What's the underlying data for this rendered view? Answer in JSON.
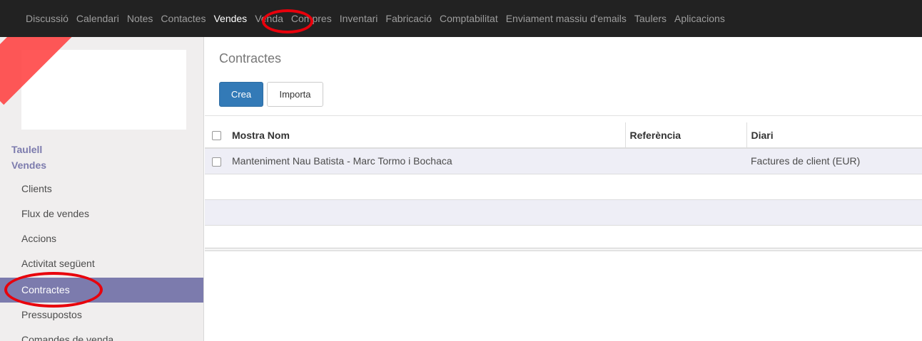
{
  "topbar": {
    "menu": [
      {
        "label": "Discussió",
        "active": false
      },
      {
        "label": "Calendari",
        "active": false
      },
      {
        "label": "Notes",
        "active": false
      },
      {
        "label": "Contactes",
        "active": false
      },
      {
        "label": "Vendes",
        "active": true
      },
      {
        "label": "Venda",
        "active": false
      },
      {
        "label": "Compres",
        "active": false
      },
      {
        "label": "Inventari",
        "active": false
      },
      {
        "label": "Fabricació",
        "active": false
      },
      {
        "label": "Comptabilitat",
        "active": false
      },
      {
        "label": "Enviament massiu d'emails",
        "active": false
      },
      {
        "label": "Taulers",
        "active": false
      },
      {
        "label": "Aplicacions",
        "active": false
      }
    ]
  },
  "sidebar": {
    "section_taulell": "Taulell",
    "section_vendes": "Vendes",
    "items": [
      {
        "label": "Clients",
        "active": false
      },
      {
        "label": "Flux de vendes",
        "active": false
      },
      {
        "label": "Accions",
        "active": false
      },
      {
        "label": "Activitat següent",
        "active": false
      },
      {
        "label": "Contractes",
        "active": true
      },
      {
        "label": "Pressupostos",
        "active": false
      },
      {
        "label": "Comandes de venda",
        "active": false
      }
    ]
  },
  "main": {
    "breadcrumb": "Contractes",
    "create_label": "Crea",
    "import_label": "Importa",
    "table": {
      "headers": [
        "Mostra Nom",
        "Referència",
        "Diari"
      ],
      "rows": [
        {
          "name": "Manteniment Nau Batista - Marc Tormo i Bochaca",
          "reference": "",
          "journal": "Factures de client (EUR)"
        },
        {
          "name": "",
          "reference": "",
          "journal": ""
        },
        {
          "name": "",
          "reference": "",
          "journal": ""
        },
        {
          "name": "",
          "reference": "",
          "journal": ""
        }
      ]
    }
  },
  "colors": {
    "topbar_bg": "#222222",
    "accent": "#7c7bad",
    "primary_button": "#337ab7",
    "annotation_red": "#e8000b"
  }
}
